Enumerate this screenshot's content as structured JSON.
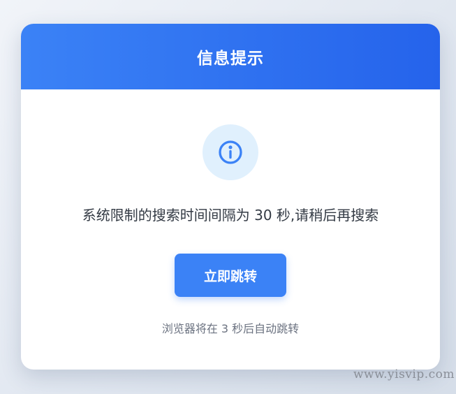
{
  "dialog": {
    "title": "信息提示",
    "icon": "info-icon",
    "message": "系统限制的搜索时间间隔为 30 秒,请稍后再搜索",
    "jump_button_label": "立即跳转",
    "countdown_text": "浏览器将在 3 秒后自动跳转"
  },
  "watermark": "www.yisvip.com",
  "colors": {
    "header_start": "#3b82f6",
    "header_end": "#2563eb",
    "button": "#3b82f6",
    "icon_bg": "#e0f0fd",
    "icon": "#3b82f6"
  }
}
